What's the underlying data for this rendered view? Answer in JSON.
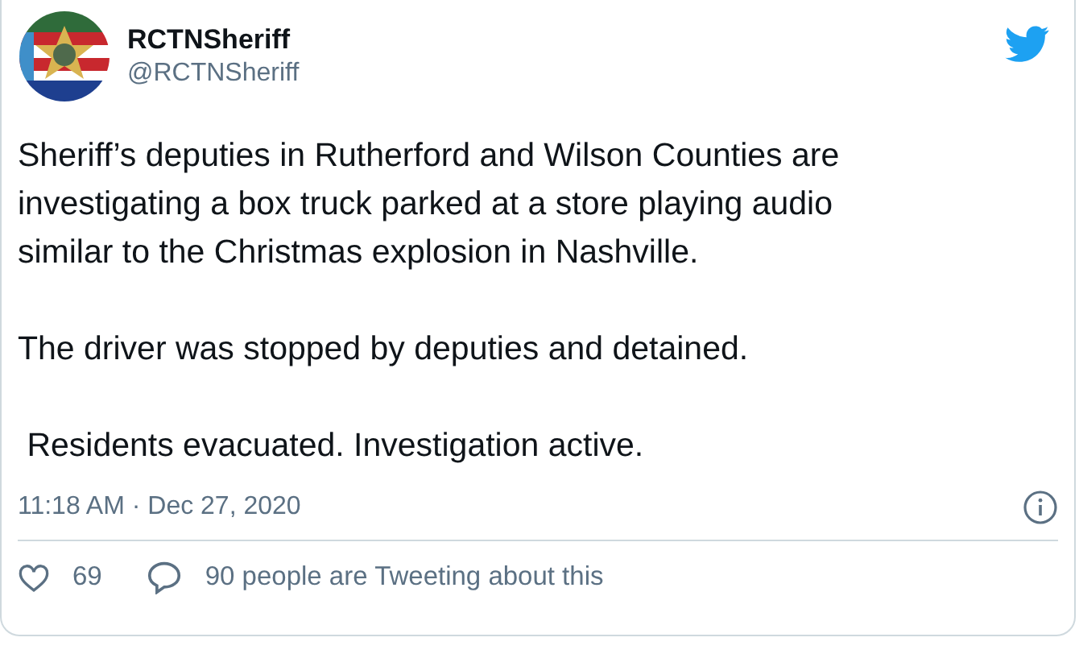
{
  "author": {
    "name": "RCTNSheriff",
    "handle": "@RCTNSheriff"
  },
  "paragraphs": [
    "Sheriff’s deputies in Rutherford and Wilson Counties are investigating a box truck parked at a store playing audio similar to the Christmas explosion in Nashville.",
    "The driver was stopped by deputies and detained.",
    " Residents evacuated. Investigation active."
  ],
  "timestamp": "11:18 AM · Dec 27, 2020",
  "actions": [
    {
      "kind": "like",
      "label": "69"
    },
    {
      "kind": "reply",
      "label": "90 people are Tweeting about this"
    }
  ]
}
